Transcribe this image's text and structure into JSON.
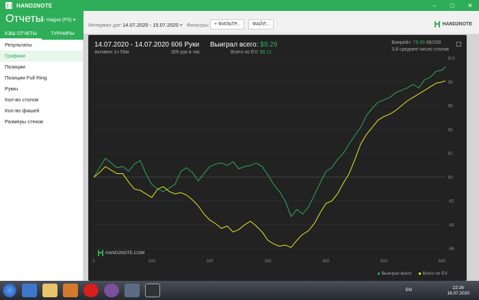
{
  "window": {
    "app_title": "HAND2NOTE",
    "controls": [
      "–",
      "□",
      "✕"
    ]
  },
  "sidebar": {
    "title": "Отчеты",
    "account": "magva (PS)",
    "tabs": [
      {
        "label": "КЭШ ОТЧЕТЫ",
        "active": true
      },
      {
        "label": "ТУРНИРЫ",
        "active": false
      }
    ],
    "items": [
      {
        "label": "Результаты",
        "active": false
      },
      {
        "label": "Графики",
        "active": true
      },
      {
        "label": "Позиции",
        "active": false
      },
      {
        "label": "Позиции Full Ring",
        "active": false
      },
      {
        "label": "Румы",
        "active": false
      },
      {
        "label": "Кол-во столов",
        "active": false
      },
      {
        "label": "Кол-во фишей",
        "active": false
      },
      {
        "label": "Размеры стеков",
        "active": false
      }
    ]
  },
  "toolbar": {
    "interval_label": "Интервал дат:",
    "interval_value": "14.07.2020 - 15.07.2020",
    "filters_label": "Фильтры:",
    "filter_button": "+ ФИЛЬТР...",
    "file_button": "ФАЙЛ...",
    "brand": "HAND2NOTE"
  },
  "stats": {
    "date_range": "14.07.2020 - 14.07.2020",
    "active_time": "Активен 1ч 59м",
    "hands": "606 Руки",
    "hands_per_hour": "305 рук в час",
    "won_label": "Выиграл всего:",
    "won_value": "$9.29",
    "ev_label": "Всего по EV:",
    "ev_value": "$8.11",
    "winrate_label": "Винрейт:",
    "winrate_value": "76.65",
    "winrate_hands": "66/100",
    "avg_tables": "3.8 среднее число столов"
  },
  "watermark": "HAND2NOTE.COM",
  "colors": {
    "accent": "#2eae58",
    "won_line": "#2eae58",
    "ev_line": "#f0f025"
  },
  "chart_data": {
    "type": "line",
    "x": [
      0,
      10,
      20,
      30,
      40,
      50,
      60,
      70,
      80,
      90,
      100,
      110,
      120,
      130,
      140,
      150,
      160,
      170,
      180,
      190,
      200,
      210,
      220,
      230,
      240,
      250,
      260,
      270,
      280,
      290,
      300,
      310,
      320,
      330,
      340,
      350,
      360,
      370,
      380,
      390,
      400,
      410,
      420,
      430,
      440,
      450,
      460,
      470,
      480,
      490,
      500,
      510,
      520,
      530,
      540,
      550,
      560,
      570,
      580,
      590,
      600,
      606
    ],
    "series": [
      {
        "name": "Выиграл всего",
        "values": [
          0,
          0.8,
          1.6,
          1.2,
          0.8,
          0.9,
          0.5,
          1.1,
          1.4,
          0.3,
          -0.6,
          -1.0,
          -1.2,
          -0.9,
          -0.6,
          0.5,
          0.8,
          0.4,
          -0.3,
          0.3,
          0.9,
          1.1,
          1.2,
          1.0,
          1.3,
          0.7,
          0.9,
          1.0,
          1.2,
          0.9,
          0.2,
          -0.6,
          -1.2,
          -2.0,
          -3.3,
          -2.7,
          -3.1,
          -2.5,
          -1.5,
          -0.5,
          0.5,
          0.8,
          1.5,
          2.0,
          2.8,
          3.5,
          4.2,
          5.2,
          5.8,
          6.3,
          6.5,
          6.7,
          7.1,
          7.3,
          7.5,
          7.8,
          7.5,
          8.2,
          8.4,
          8.9,
          9.0,
          9.29
        ]
      },
      {
        "name": "Всего по EV",
        "values": [
          0,
          0.4,
          0.9,
          0.6,
          0.3,
          0.3,
          -0.4,
          -1.0,
          -1.1,
          -1.4,
          -1.7,
          -1.0,
          -0.8,
          -1.2,
          -1.4,
          -1.3,
          -1.5,
          -1.9,
          -2.4,
          -3.1,
          -3.6,
          -3.9,
          -4.3,
          -4.1,
          -4.6,
          -4.4,
          -4.0,
          -3.7,
          -4.1,
          -4.6,
          -5.3,
          -5.6,
          -5.8,
          -5.7,
          -5.9,
          -5.3,
          -4.8,
          -4.5,
          -3.9,
          -3.0,
          -2.2,
          -2.0,
          -1.4,
          -0.5,
          0.3,
          1.5,
          2.8,
          3.6,
          4.2,
          4.8,
          5.1,
          5.3,
          5.6,
          6.0,
          6.4,
          6.7,
          7.0,
          7.3,
          7.6,
          7.9,
          8.0,
          8.11
        ]
      }
    ],
    "xlim": [
      0,
      606
    ],
    "ylim": [
      -6,
      10
    ],
    "x_ticks": [
      0,
      100,
      200,
      300,
      400,
      500,
      600
    ],
    "y_ticks": [
      10,
      8,
      6,
      4,
      2,
      0,
      -2,
      -4,
      -6
    ],
    "y_tick_labels": [
      "$10",
      "$8",
      "$6",
      "$4",
      "$2",
      "$0",
      "-$2",
      "-$4",
      "-$6"
    ],
    "grid": true,
    "legend_position": "bottom-right"
  }
}
